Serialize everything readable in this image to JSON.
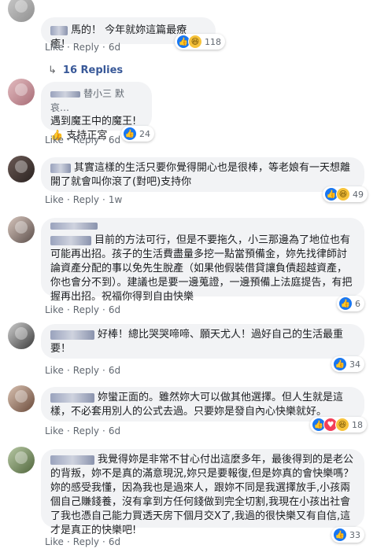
{
  "actions": {
    "like": "Like",
    "reply": "Reply",
    "sep": "·"
  },
  "comments": [
    {
      "text": "馬的！ 今年就妳這篇最療癒！",
      "reaction_count": "118",
      "reactions": [
        "like-icon",
        "haha-icon"
      ],
      "time": "6d"
    },
    {
      "replies_label": "16 Replies"
    },
    {
      "quote": "替小三 默哀…",
      "line1": "遇到魔王中的魔王!",
      "line2": "👍 支持正宮",
      "reaction_count": "24",
      "reactions": [
        "like-icon"
      ],
      "time": "6d"
    },
    {
      "text": "其實這樣的生活只要你覺得開心也是很棒，等老娘有一天想離開了就會叫你滾了(對吧)支持你",
      "reaction_count": "49",
      "reactions": [
        "like-icon",
        "haha-icon"
      ],
      "time": "1w"
    },
    {
      "text": "目前的方法可行，但是不要拖久，小三那邊為了地位也有可能再出招。孩子的生活費盡量多挖一點當預備金，妳先找律師討論資產分配的事以免先生脫產（如果他假裝借貸讓負債超越資產，你也會分不到）。建議也是要一邊蒐證，一邊預備上法庭提告，有把握再出招。祝福你得到自由快樂",
      "reaction_count": "6",
      "reactions": [
        "like-icon"
      ],
      "time": "6d"
    },
    {
      "text": "好棒！總比哭哭啼啼、願天尤人！過好自己的生活最重要！",
      "reaction_count": "34",
      "reactions": [
        "like-icon"
      ],
      "time": "6d"
    },
    {
      "text": "妳蠻正面的。雖然妳大可以做其他選擇。但人生就是這樣，不必套用別人的公式去過。只要妳是發自內心快樂就好。",
      "reaction_count": "18",
      "reactions": [
        "like-icon",
        "love-icon",
        "haha-icon"
      ],
      "time": "6d"
    },
    {
      "text": "我覺得妳是非常不甘心付出這麼多年，最後得到的是老公的背叛，妳不是真的滿意現況,妳只是要報復,但是妳真的會快樂嗎？妳的感受我懂，因為我也是過來人，跟妳不同是我選擇放手,小孩兩個自己賺錢養，沒有拿到方任何錢做到完全切割,我現在小孩出社會了我也憑自己能力買透天房下個月交X了,我過的很快樂又有自信,這才是真正的快樂吧!",
      "reaction_count": "33",
      "reactions": [
        "like-icon"
      ],
      "time": "6d"
    }
  ]
}
